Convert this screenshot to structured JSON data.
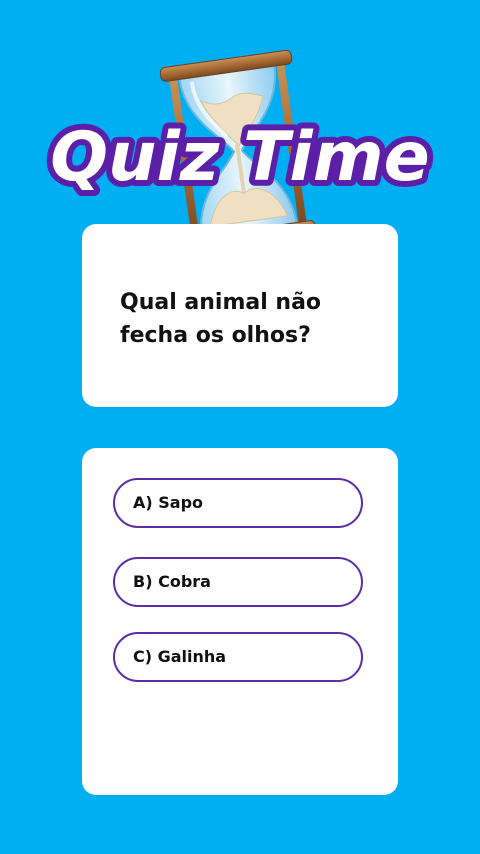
{
  "colors": {
    "background": "#00aef2",
    "card": "#ffffff",
    "title_fill": "#ffffff",
    "title_stroke": "#5b1fa8",
    "option_border": "#5b2ca6",
    "text": "#111111"
  },
  "header": {
    "title": "Quiz Time",
    "icon": "hourglass-icon"
  },
  "question": {
    "text": "Qual animal não fecha os olhos?"
  },
  "answers": [
    {
      "label": "A) Sapo"
    },
    {
      "label": "B) Cobra"
    },
    {
      "label": "C) Galinha"
    }
  ]
}
